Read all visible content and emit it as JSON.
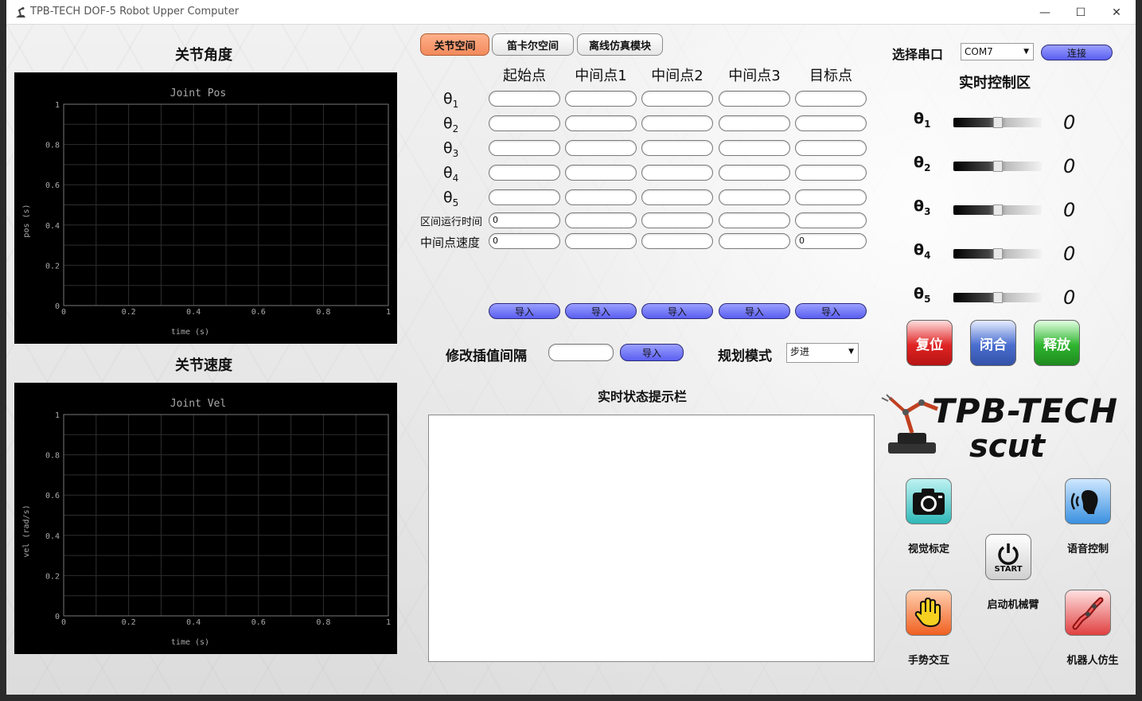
{
  "window": {
    "title": "TPB-TECH DOF-5 Robot Upper Computer",
    "minimize": "—",
    "maximize": "☐",
    "close": "✕"
  },
  "left": {
    "angle_heading": "关节角度",
    "velocity_heading": "关节速度"
  },
  "plots": [
    {
      "title": "Joint Pos",
      "xlabel": "time (s)",
      "ylabel": "pos (s)",
      "xticks": [
        "0",
        "0.2",
        "0.4",
        "0.6",
        "0.8",
        "1"
      ],
      "yticks": [
        "0",
        "0.2",
        "0.4",
        "0.6",
        "0.8",
        "1"
      ]
    },
    {
      "title": "Joint Vel",
      "xlabel": "time (s)",
      "ylabel": "vel (rad/s)",
      "xticks": [
        "0",
        "0.2",
        "0.4",
        "0.6",
        "0.8",
        "1"
      ],
      "yticks": [
        "0",
        "0.2",
        "0.4",
        "0.6",
        "0.8",
        "1"
      ]
    }
  ],
  "tabs": [
    {
      "label": "关节空间",
      "active": true
    },
    {
      "label": "笛卡尔空间",
      "active": false
    },
    {
      "label": "离线仿真模块",
      "active": false
    }
  ],
  "table": {
    "columns": [
      "起始点",
      "中间点1",
      "中间点2",
      "中间点3",
      "目标点"
    ],
    "theta_rows": [
      {
        "symbol": "θ",
        "sub": "1"
      },
      {
        "symbol": "θ",
        "sub": "2"
      },
      {
        "symbol": "θ",
        "sub": "3"
      },
      {
        "symbol": "θ",
        "sub": "4"
      },
      {
        "symbol": "θ",
        "sub": "5"
      }
    ],
    "interval_label": "区间运行时间",
    "interval_values": [
      "0",
      "",
      "",
      "",
      ""
    ],
    "speed_label": "中间点速度",
    "speed_values": [
      "0",
      "",
      "",
      "",
      "0"
    ],
    "import_label": "导入"
  },
  "interp": {
    "label": "修改插值间隔",
    "value": "",
    "button": "导入"
  },
  "mode": {
    "label": "规划模式",
    "selected": "步进"
  },
  "status": {
    "heading": "实时状态提示栏",
    "text": ""
  },
  "serial": {
    "label": "选择串口",
    "port": "COM7",
    "connect": "连接"
  },
  "realtime": {
    "heading": "实时控制区",
    "sliders": [
      {
        "symbol": "θ",
        "sub": "1",
        "value": "0",
        "level": 0.5
      },
      {
        "symbol": "θ",
        "sub": "2",
        "value": "0",
        "level": 0.5
      },
      {
        "symbol": "θ",
        "sub": "3",
        "value": "0",
        "level": 0.5
      },
      {
        "symbol": "θ",
        "sub": "4",
        "value": "0",
        "level": 0.5
      },
      {
        "symbol": "θ",
        "sub": "5",
        "value": "0",
        "level": 0.5
      }
    ]
  },
  "actions": {
    "reset": "复位",
    "close": "闭合",
    "release": "释放"
  },
  "logo": {
    "line1": "TPB-TECH",
    "line2": "scut"
  },
  "features": {
    "vision": "视觉标定",
    "voice": "语音控制",
    "start_label": "启动机械臂",
    "start_text": "START",
    "gesture": "手势交互",
    "robot_sim": "机器人仿生"
  },
  "colors": {
    "tab_active": "#f28a5c",
    "btn_blue": "#5a5ef0",
    "reset": "#e02424",
    "close": "#4a6fd0",
    "release": "#2fb52f"
  }
}
